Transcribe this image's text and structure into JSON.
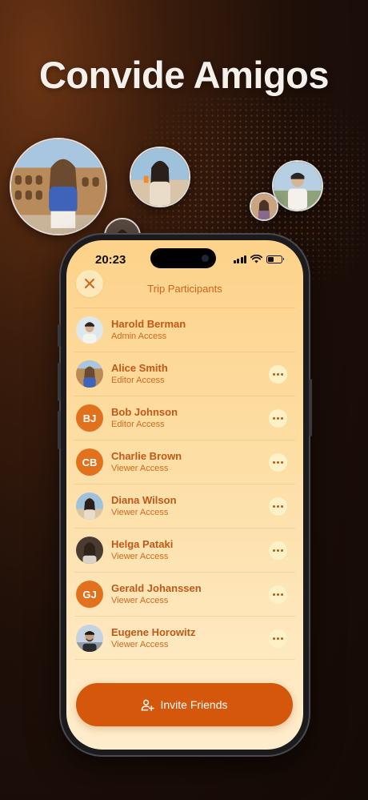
{
  "headline": "Convide Amigos",
  "status_bar": {
    "time": "20:23"
  },
  "screen": {
    "title": "Trip Participants",
    "close_icon": "close-icon"
  },
  "participants": [
    {
      "name": "Harold Berman",
      "role": "Admin Access",
      "avatar": "photo",
      "menu": false
    },
    {
      "name": "Alice Smith",
      "role": "Editor Access",
      "avatar": "photo",
      "menu": true
    },
    {
      "name": "Bob Johnson",
      "role": "Editor Access",
      "avatar": "initials",
      "initials": "BJ",
      "menu": true
    },
    {
      "name": "Charlie Brown",
      "role": "Viewer Access",
      "avatar": "initials",
      "initials": "CB",
      "menu": true
    },
    {
      "name": "Diana Wilson",
      "role": "Viewer Access",
      "avatar": "photo",
      "menu": true
    },
    {
      "name": "Helga Pataki",
      "role": "Viewer Access",
      "avatar": "photo",
      "menu": true
    },
    {
      "name": "Gerald Johanssen",
      "role": "Viewer Access",
      "avatar": "initials",
      "initials": "GJ",
      "menu": true
    },
    {
      "name": "Eugene Horowitz",
      "role": "Viewer Access",
      "avatar": "photo",
      "menu": true
    }
  ],
  "invite_button": {
    "label": "Invite Friends",
    "icon": "add-person-icon"
  },
  "colors": {
    "accent": "#d4570c",
    "text_orange": "#c35716",
    "initials_bg": "#e2711d",
    "screen_top": "#fdd28a",
    "screen_bottom": "#feedcd",
    "background": "#1e0f08"
  }
}
